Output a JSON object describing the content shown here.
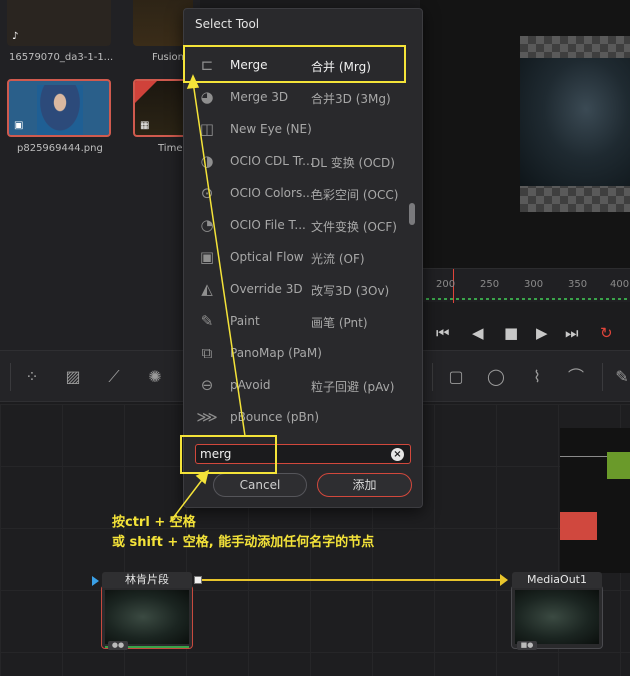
{
  "media_pool": {
    "items": [
      {
        "label": "16579070_da3-1-1...",
        "badge": "♪"
      },
      {
        "label": "Fusion"
      },
      {
        "label": "p825969444.png",
        "badge": "▣"
      },
      {
        "label": "Time"
      }
    ]
  },
  "viewer": {
    "ruler_ticks": [
      "200",
      "250",
      "300",
      "350",
      "400"
    ]
  },
  "dialog": {
    "title": "Select Tool",
    "tools": [
      {
        "name": "Merge",
        "alias": "合并 (Mrg)",
        "icon": "merge-icon"
      },
      {
        "name": "Merge 3D",
        "alias": "合并3D (3Mg)",
        "icon": "merge3d-icon"
      },
      {
        "name": "New Eye (NE)",
        "alias": "",
        "icon": "new-eye-icon"
      },
      {
        "name": "OCIO CDL Tr...",
        "alias": "DL 变换 (OCD)",
        "icon": "ocio-cdl-icon"
      },
      {
        "name": "OCIO Colors...",
        "alias": "色彩空间 (OCC)",
        "icon": "ocio-colorspace-icon"
      },
      {
        "name": "OCIO File T...",
        "alias": "文件变换 (OCF)",
        "icon": "ocio-file-icon"
      },
      {
        "name": "Optical Flow",
        "alias": "光流 (OF)",
        "icon": "optical-flow-icon"
      },
      {
        "name": "Override 3D",
        "alias": "改写3D (3Ov)",
        "icon": "override3d-icon"
      },
      {
        "name": "Paint",
        "alias": "画笔 (Pnt)",
        "icon": "paint-icon"
      },
      {
        "name": "PanoMap (PaM)",
        "alias": "",
        "icon": "panomap-icon"
      },
      {
        "name": "pAvoid",
        "alias": "粒子回避 (pAv)",
        "icon": "pavoid-icon"
      },
      {
        "name": "pBounce (pBn)",
        "alias": "",
        "icon": "pbounce-icon"
      }
    ],
    "search_value": "merg",
    "cancel_label": "Cancel",
    "add_label": "添加"
  },
  "nodes": {
    "source_title": "林肯片段",
    "output_title": "MediaOut1"
  },
  "annotation": {
    "line1": "按ctrl + 空格",
    "line2": "或 shift + 空格, 能手动添加任何名字的节点"
  },
  "colors": {
    "annotation": "#f4e339",
    "accent_red": "#d2483c",
    "connector": "#e8c52c"
  }
}
